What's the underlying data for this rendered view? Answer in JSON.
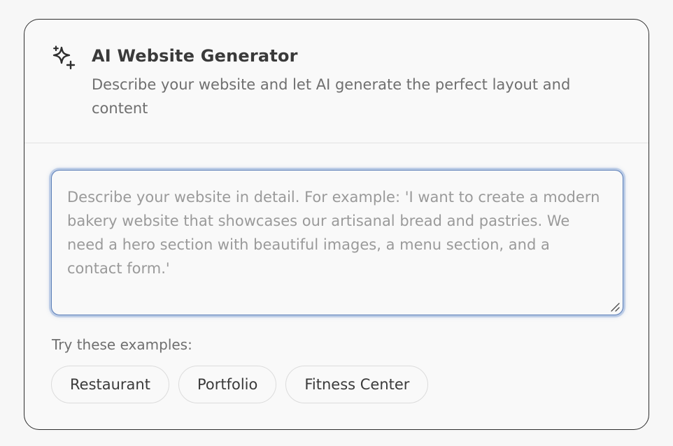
{
  "header": {
    "icon": "sparkles-icon",
    "title": "AI Website Generator",
    "subtitle": "Describe your website and let AI generate the perfect layout and content"
  },
  "prompt": {
    "value": "",
    "placeholder": "Describe your website in detail. For example: 'I want to create a modern bakery website that showcases our artisanal bread and pastries. We need a hero section with beautiful images, a menu section, and a contact form.'"
  },
  "examples": {
    "label": "Try these examples:",
    "items": [
      "Restaurant",
      "Portfolio",
      "Fitness Center"
    ]
  },
  "colors": {
    "focus_ring": "#5c7fb8",
    "border": "#2e2e2e",
    "text": "#3a3a3a",
    "muted": "#6f6f6f"
  }
}
